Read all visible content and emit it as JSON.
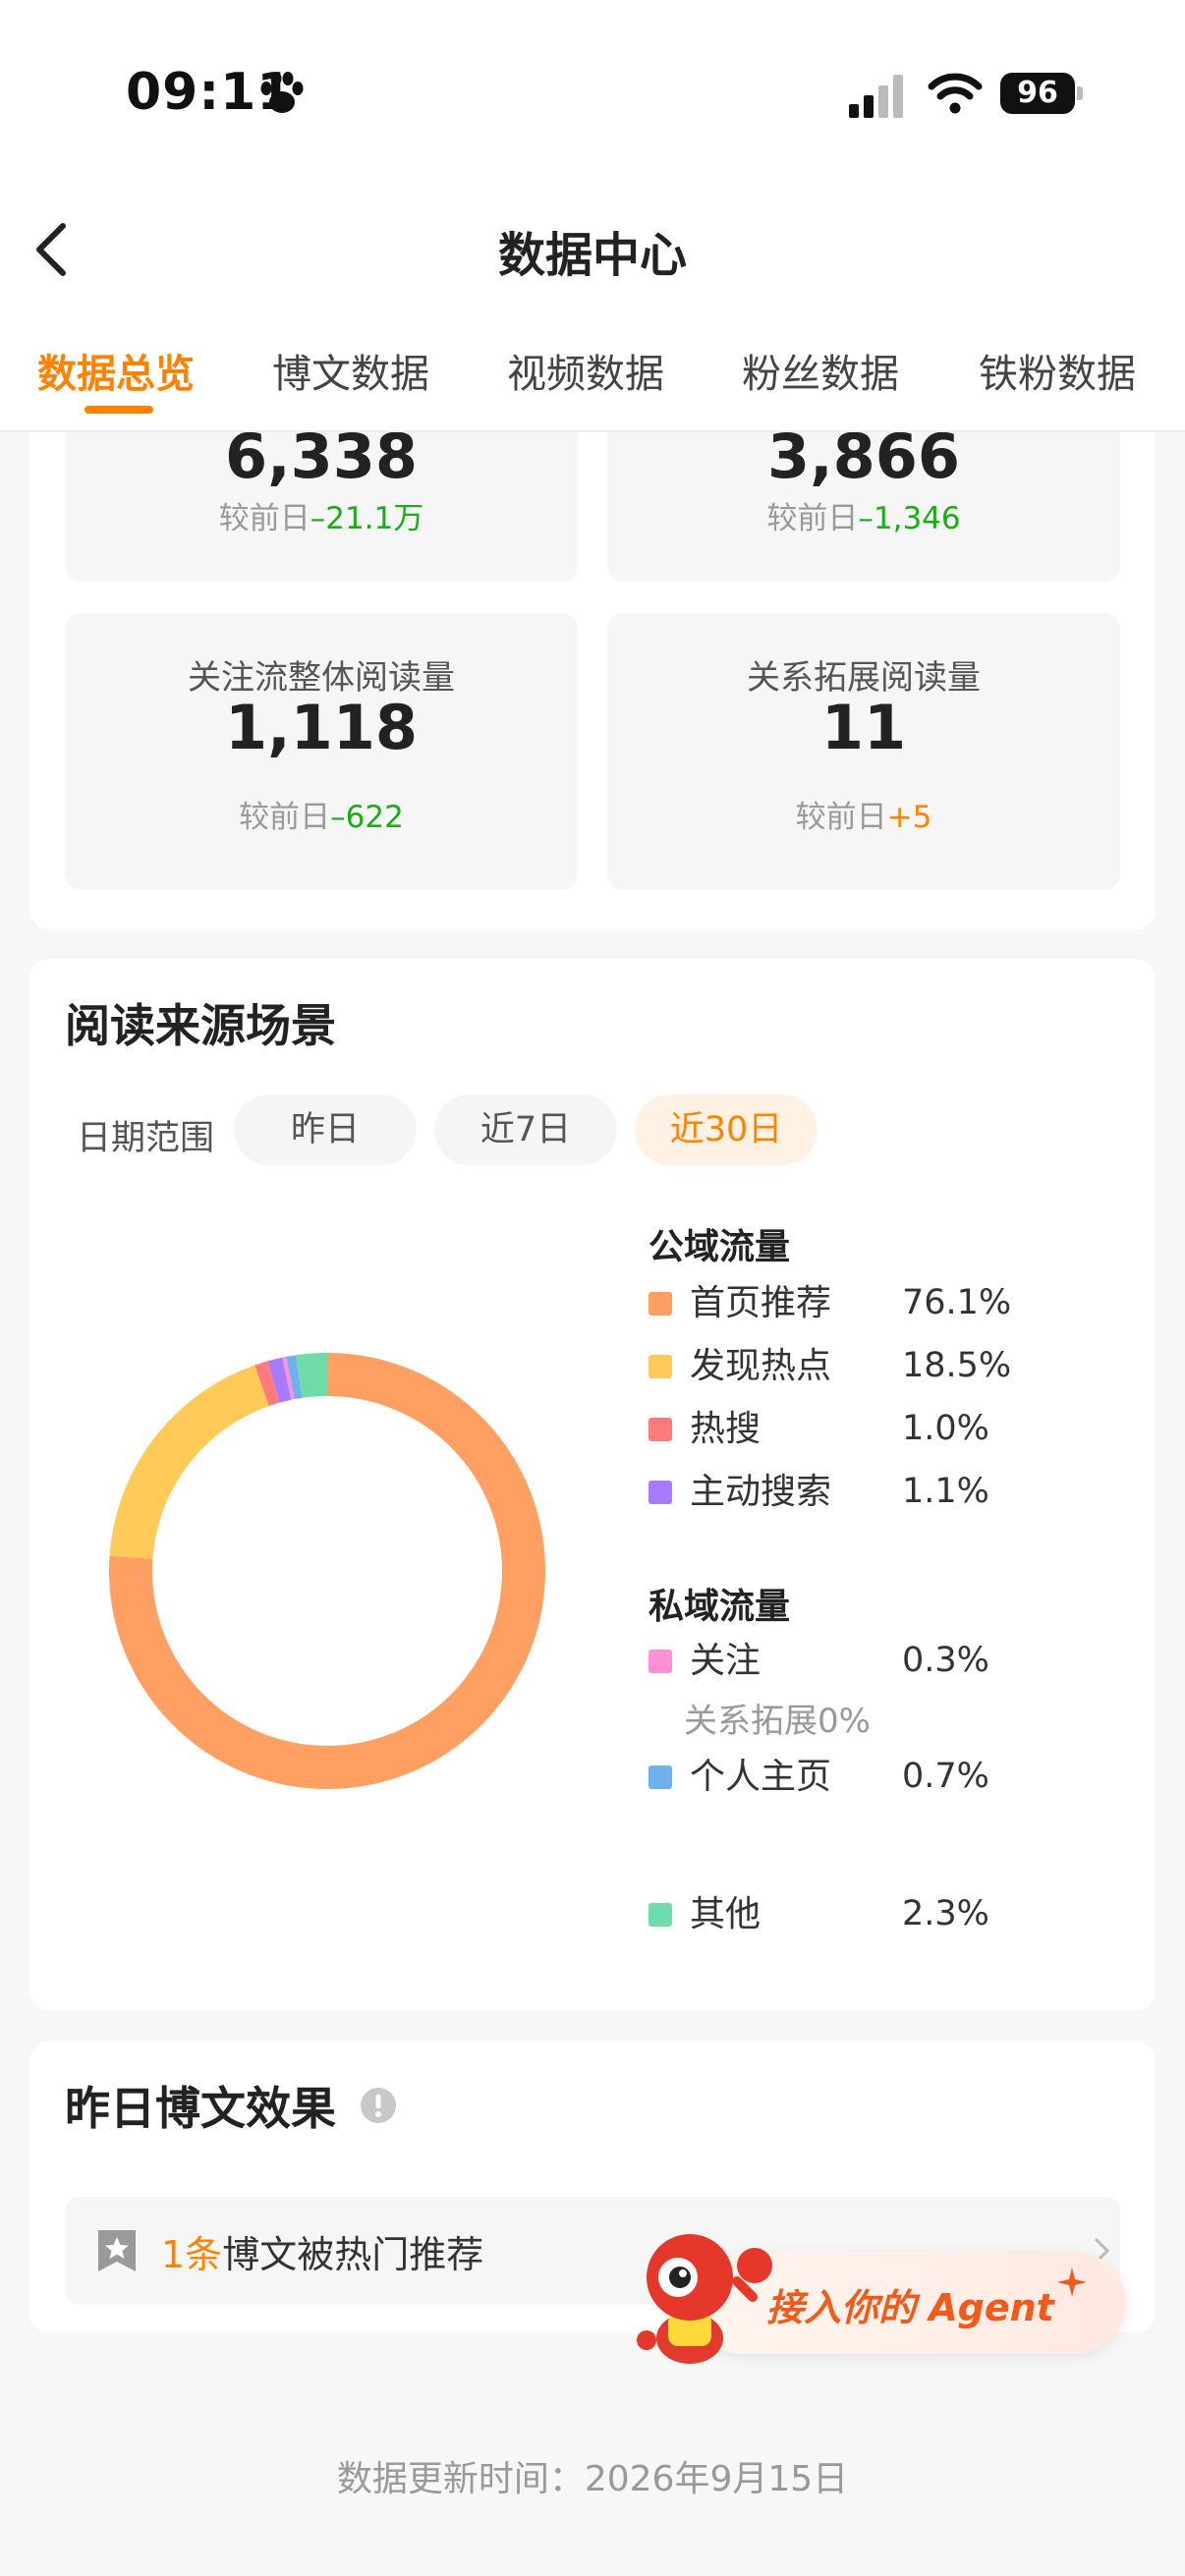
{
  "status": {
    "time": "09:11",
    "battery": "96"
  },
  "nav": {
    "title": "数据中心"
  },
  "tabs": [
    {
      "label": "数据总览",
      "active": true
    },
    {
      "label": "博文数据",
      "active": false
    },
    {
      "label": "视频数据",
      "active": false
    },
    {
      "label": "粉丝数据",
      "active": false
    },
    {
      "label": "铁粉数据",
      "active": false
    }
  ],
  "stats": {
    "top_left": {
      "value": "6,338",
      "delta_prefix": "较前日",
      "delta": "–21.1万"
    },
    "top_right": {
      "value": "3,866",
      "delta_prefix": "较前日",
      "delta": "–1,346"
    },
    "follow_read": {
      "label": "关注流整体阅读量",
      "value": "1,118",
      "delta_prefix": "较前日",
      "delta": "–622"
    },
    "relation_read": {
      "label": "关系拓展阅读量",
      "value": "11",
      "delta_prefix": "较前日",
      "delta": "+5"
    }
  },
  "source": {
    "title": "阅读来源场景",
    "date_label": "日期范围",
    "chips": [
      "昨日",
      "近7日",
      "近30日"
    ],
    "active_chip": "近30日",
    "public_head": "公域流量",
    "private_head": "私域流量",
    "relation_sub": "关系拓展0%"
  },
  "chart_data": {
    "type": "pie",
    "categories": [
      "首页推荐",
      "发现热点",
      "热搜",
      "主动搜索",
      "关注",
      "个人主页",
      "其他"
    ],
    "values": [
      76.1,
      18.5,
      1.0,
      1.1,
      0.3,
      0.7,
      2.3
    ],
    "labels": [
      "76.1%",
      "18.5%",
      "1.0%",
      "1.1%",
      "0.3%",
      "0.7%",
      "2.3%"
    ],
    "colors": [
      "#ff9f62",
      "#ffca57",
      "#ff7a7a",
      "#a77bff",
      "#ff8fd8",
      "#6fb0ee",
      "#6fdba8"
    ]
  },
  "yesterday": {
    "title": "昨日博文效果",
    "count": "1条",
    "text": "博文被热门推荐",
    "agent_label": "接入你的 Agent"
  },
  "footer": {
    "update_text": "数据更新时间：2026年9月15日"
  }
}
